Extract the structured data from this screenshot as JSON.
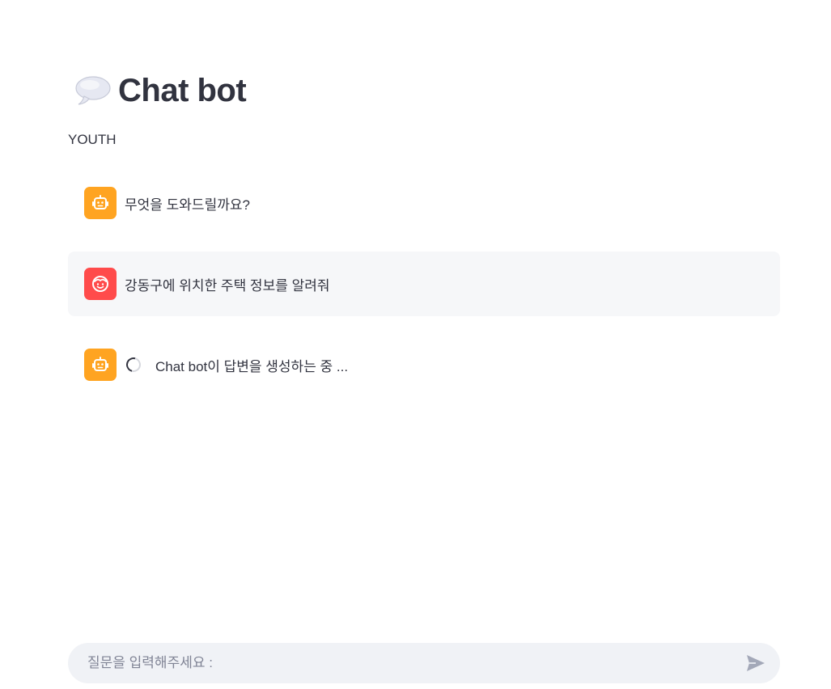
{
  "header": {
    "title": "Chat bot",
    "emoji_icon": "speech-balloon-icon",
    "caption": "YOUTH"
  },
  "messages": [
    {
      "role": "assistant",
      "avatar_icon": "robot-icon",
      "text": "무엇을 도와드릴까요?"
    },
    {
      "role": "user",
      "avatar_icon": "smiley-face-icon",
      "text": "강동구에 위치한 주택 정보를 알려줘"
    },
    {
      "role": "assistant",
      "avatar_icon": "robot-icon",
      "status_text": "Chat bot이 답변을 생성하는 중 ..."
    }
  ],
  "chat_input": {
    "placeholder": "질문을 입력해주세요 :",
    "value": "",
    "send_icon": "send-arrow-icon"
  },
  "colors": {
    "bot_avatar": "#ffa421",
    "user_avatar": "#ff4b4b",
    "user_message_bg": "#f6f7f9",
    "input_bg": "#f0f2f6",
    "text": "#31333f"
  }
}
